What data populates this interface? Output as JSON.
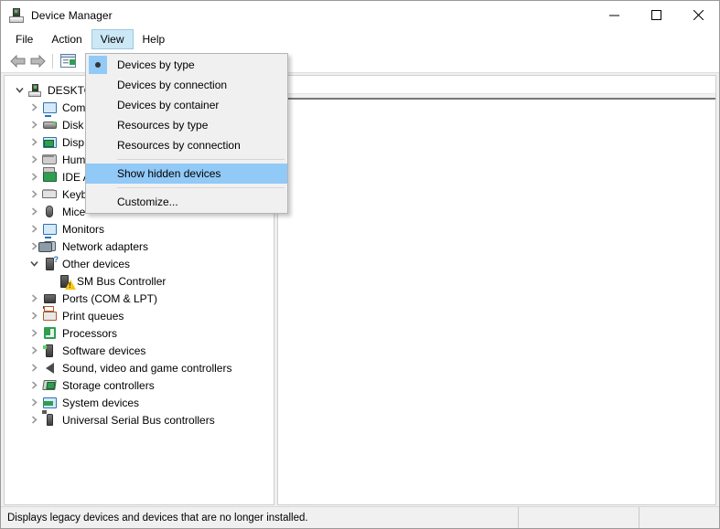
{
  "window": {
    "title": "Device Manager",
    "icon": "device-manager-icon",
    "controls": {
      "minimize": "Minimize",
      "maximize": "Maximize",
      "close": "Close"
    }
  },
  "menubar": {
    "items": [
      {
        "label": "File",
        "active": false
      },
      {
        "label": "Action",
        "active": false
      },
      {
        "label": "View",
        "active": true
      },
      {
        "label": "Help",
        "active": false
      }
    ]
  },
  "toolbar": {
    "buttons": [
      {
        "name": "back-button",
        "icon": "back-arrow-icon"
      },
      {
        "name": "forward-button",
        "icon": "forward-arrow-icon"
      },
      {
        "name": "properties-button",
        "icon": "properties-icon"
      }
    ]
  },
  "view_menu": {
    "items": [
      {
        "label": "Devices by type",
        "checked": true,
        "highlight": false,
        "separator_after": false
      },
      {
        "label": "Devices by connection",
        "checked": false,
        "highlight": false,
        "separator_after": false
      },
      {
        "label": "Devices by container",
        "checked": false,
        "highlight": false,
        "separator_after": false
      },
      {
        "label": "Resources by type",
        "checked": false,
        "highlight": false,
        "separator_after": false
      },
      {
        "label": "Resources by connection",
        "checked": false,
        "highlight": false,
        "separator_after": true
      },
      {
        "label": "Show hidden devices",
        "checked": false,
        "highlight": true,
        "separator_after": true
      },
      {
        "label": "Customize...",
        "checked": false,
        "highlight": false,
        "separator_after": false
      }
    ]
  },
  "tree": {
    "nodes": [
      {
        "label": "DESKTO",
        "depth": 0,
        "state": "expanded",
        "icon": "computer-root-icon"
      },
      {
        "label": "Com",
        "depth": 1,
        "state": "collapsed",
        "icon": "computer-icon"
      },
      {
        "label": "Disk",
        "depth": 1,
        "state": "collapsed",
        "icon": "disk-drive-icon"
      },
      {
        "label": "Disp",
        "depth": 1,
        "state": "collapsed",
        "icon": "display-adapter-icon"
      },
      {
        "label": "Hum",
        "depth": 1,
        "state": "collapsed",
        "icon": "human-interface-device-icon"
      },
      {
        "label": "IDE A",
        "depth": 1,
        "state": "collapsed",
        "icon": "ide-controller-icon"
      },
      {
        "label": "Keyb",
        "depth": 1,
        "state": "collapsed",
        "icon": "keyboard-icon"
      },
      {
        "label": "Mice",
        "depth": 1,
        "state": "collapsed",
        "icon": "mouse-icon"
      },
      {
        "label": "Monitors",
        "depth": 1,
        "state": "collapsed",
        "icon": "monitor-icon"
      },
      {
        "label": "Network adapters",
        "depth": 1,
        "state": "collapsed",
        "icon": "network-adapter-icon"
      },
      {
        "label": "Other devices",
        "depth": 1,
        "state": "expanded",
        "icon": "other-devices-icon"
      },
      {
        "label": "SM Bus Controller",
        "depth": 2,
        "state": "leaf",
        "icon": "unknown-device-warning-icon"
      },
      {
        "label": "Ports (COM & LPT)",
        "depth": 1,
        "state": "collapsed",
        "icon": "ports-icon"
      },
      {
        "label": "Print queues",
        "depth": 1,
        "state": "collapsed",
        "icon": "print-queue-icon"
      },
      {
        "label": "Processors",
        "depth": 1,
        "state": "collapsed",
        "icon": "processor-icon"
      },
      {
        "label": "Software devices",
        "depth": 1,
        "state": "collapsed",
        "icon": "software-device-icon"
      },
      {
        "label": "Sound, video and game controllers",
        "depth": 1,
        "state": "collapsed",
        "icon": "sound-controller-icon"
      },
      {
        "label": "Storage controllers",
        "depth": 1,
        "state": "collapsed",
        "icon": "storage-controller-icon"
      },
      {
        "label": "System devices",
        "depth": 1,
        "state": "collapsed",
        "icon": "system-device-icon"
      },
      {
        "label": "Universal Serial Bus controllers",
        "depth": 1,
        "state": "collapsed",
        "icon": "usb-controller-icon"
      }
    ]
  },
  "statusbar": {
    "message": "Displays legacy devices and devices that are no longer installed.",
    "pane_mid": "",
    "pane_end": ""
  },
  "colors": {
    "menu_highlight": "#91c9f7",
    "menubar_active": "#cce8f6",
    "warning": "#f5c518",
    "window_bg": "#ffffff",
    "chrome_bg": "#f0f0f0"
  }
}
